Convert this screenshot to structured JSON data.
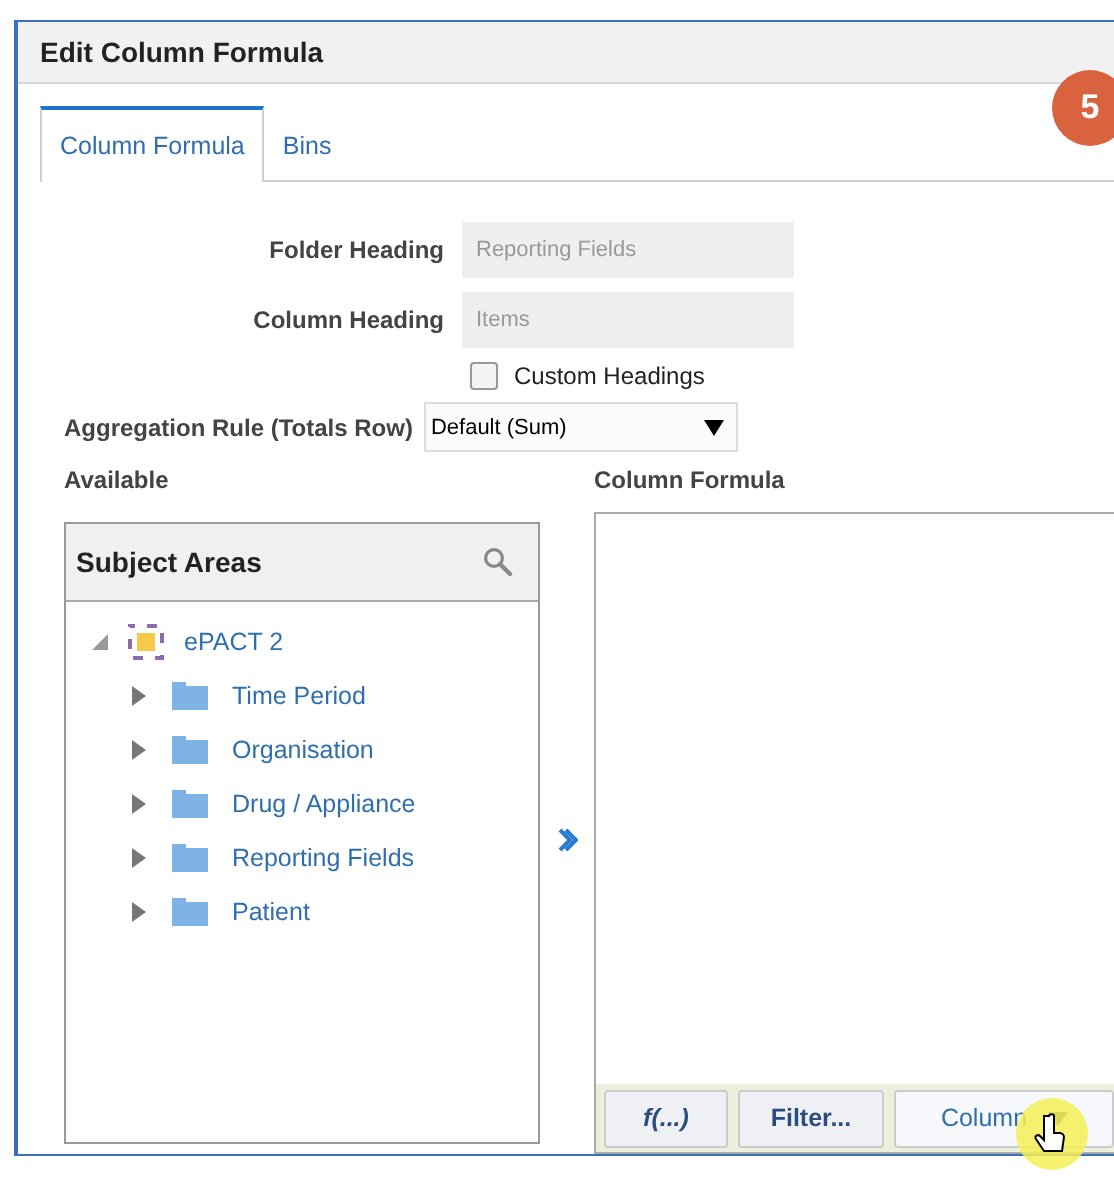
{
  "dialog": {
    "title": "Edit Column Formula"
  },
  "step_badge": "5",
  "tabs": [
    {
      "label": "Column Formula",
      "selected": true
    },
    {
      "label": "Bins",
      "selected": false
    }
  ],
  "fields": [
    {
      "label": "Folder Heading",
      "value": "Reporting Fields",
      "disabled": true
    },
    {
      "label": "Column Heading",
      "value": "Items",
      "disabled": true
    }
  ],
  "custom_headings": {
    "label": "Custom Headings",
    "checked": false
  },
  "aggregation": {
    "label": "Aggregation Rule (Totals Row)",
    "value": "Default (Sum)"
  },
  "available": {
    "label": "Available",
    "panel_title": "Subject Areas",
    "tree": [
      {
        "label": "ePACT 2",
        "expanded": true,
        "children": [
          {
            "label": "Time Period",
            "expanded": false
          },
          {
            "label": "Organisation",
            "expanded": false
          },
          {
            "label": "Drug / Appliance",
            "expanded": false
          },
          {
            "label": "Reporting Fields",
            "expanded": false
          },
          {
            "label": "Patient",
            "expanded": false
          }
        ]
      }
    ]
  },
  "formula": {
    "label": "Column Formula",
    "buttons": [
      {
        "label": "f(...)",
        "kind": "function"
      },
      {
        "label": "Filter...",
        "kind": "plain"
      },
      {
        "label": "Column",
        "kind": "dropdown"
      }
    ]
  }
}
